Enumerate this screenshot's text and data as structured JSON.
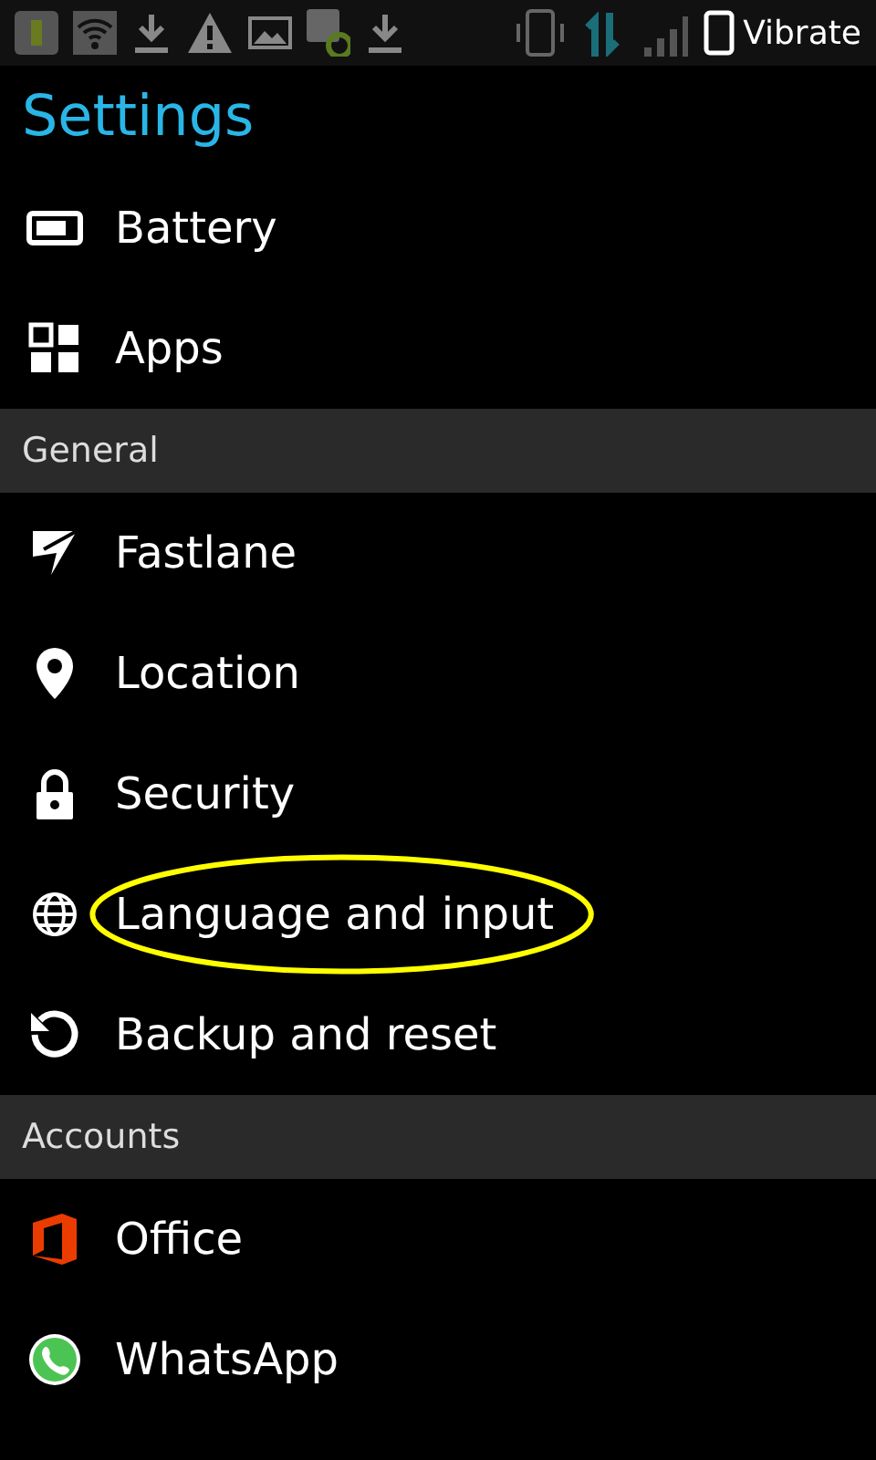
{
  "status_bar": {
    "text": "Vibrate"
  },
  "title": "Settings",
  "rows": [
    {
      "kind": "item",
      "label": "Battery",
      "circled": false
    },
    {
      "kind": "item",
      "label": "Apps",
      "circled": false
    },
    {
      "kind": "header",
      "label": "General"
    },
    {
      "kind": "item",
      "label": "Fastlane",
      "circled": false
    },
    {
      "kind": "item",
      "label": "Location",
      "circled": false
    },
    {
      "kind": "item",
      "label": "Security",
      "circled": false
    },
    {
      "kind": "item",
      "label": "Language and input",
      "circled": true
    },
    {
      "kind": "item",
      "label": "Backup and reset",
      "circled": false
    },
    {
      "kind": "header",
      "label": "Accounts"
    },
    {
      "kind": "item",
      "label": "Office",
      "circled": false
    },
    {
      "kind": "item",
      "label": "WhatsApp",
      "circled": false
    }
  ]
}
